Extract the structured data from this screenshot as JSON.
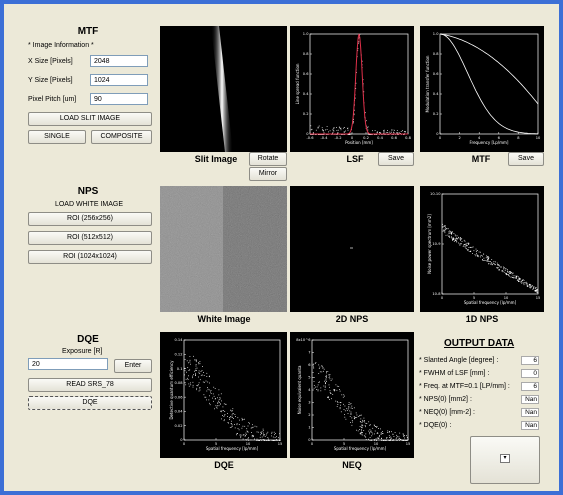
{
  "mtf": {
    "title": "MTF",
    "image_info": "* Image Information *",
    "x_size_label": "X Size [Pixels]",
    "x_size_value": "2048",
    "y_size_label": "Y Size [Pixels]",
    "y_size_value": "1024",
    "pixel_pitch_label": "Pixel Pitch [um]",
    "pixel_pitch_value": "90",
    "load_slit_image": "LOAD SLIT IMAGE",
    "single": "SINGLE",
    "composite": "COMPOSITE"
  },
  "nps": {
    "title": "NPS",
    "load_white_image": "LOAD WHITE IMAGE",
    "roi_256": "ROI (256x256)",
    "roi_512": "ROI (512x512)",
    "roi_1024": "ROI (1024x1024)"
  },
  "dqe": {
    "title": "DQE",
    "exposure_label": "Exposure [R]",
    "exposure_value": "20",
    "enter": "Enter",
    "read_srs": "READ SRS_78",
    "dqe_button": "DQE"
  },
  "panels": {
    "slit_image": "Slit Image",
    "rotate": "Rotate",
    "mirror": "Mirror",
    "lsf": "LSF",
    "lsf_save": "Save",
    "mtf": "MTF",
    "mtf_save": "Save",
    "white_image": "White Image",
    "nps_2d": "2D NPS",
    "nps_1d": "1D NPS",
    "dqe": "DQE",
    "neq": "NEQ"
  },
  "plots": {
    "lsf": {
      "ylabel": "Line spread function",
      "xlabel": "Position [mm]",
      "xticks": [
        "-0.6",
        "-0.4",
        "-0.2",
        "0",
        "0.2",
        "0.4",
        "0.6",
        "0.8"
      ],
      "yticks": [
        "0",
        "0.2",
        "0.4",
        "0.6",
        "0.8",
        "1.0"
      ]
    },
    "mtf": {
      "ylabel": "Modulation transfer function",
      "xlabel": "Frequency [Lp/mm]",
      "xticks": [
        "0",
        "2",
        "4",
        "6",
        "8",
        "10"
      ],
      "yticks": [
        "0",
        "0.2",
        "0.4",
        "0.6",
        "0.8",
        "1.0"
      ]
    },
    "nps1d": {
      "ylabel": "Noise power spectrum [mm2]",
      "xlabel": "Spatial frequency [lp/mm]",
      "xticks": [
        "0",
        "5",
        "10",
        "15"
      ],
      "yticks": [
        "10-8",
        "10-9",
        "10-10"
      ]
    },
    "dqe": {
      "ylabel": "Detective quantum efficiency",
      "xlabel": "Spatial frequency [lp/mm]",
      "xticks": [
        "0",
        "5",
        "10",
        "15"
      ],
      "yticks": [
        "0",
        "0.02",
        "0.04",
        "0.06",
        "0.08",
        "0.1",
        "0.12",
        "0.14"
      ]
    },
    "neq": {
      "ylabel": "Noise equivalent quanta",
      "xlabel": "Spatial frequency [lp/mm]",
      "xticks": [
        "0",
        "5",
        "10",
        "15"
      ],
      "yticks": [
        "0",
        "1",
        "2",
        "3",
        "4",
        "5",
        "6",
        "7",
        "8x10^6"
      ]
    }
  },
  "output": {
    "title": "OUTPUT DATA",
    "rows": [
      {
        "label": "* Slanted Angle [degree] :",
        "value": "6"
      },
      {
        "label": "* FWHM of LSF [mm] :",
        "value": "0"
      },
      {
        "label": "* Freq. at MTF=0.1 [LP/mm] :",
        "value": "6"
      },
      {
        "label": "* NPS(0) [mm2] :",
        "value": "Nan"
      },
      {
        "label": "* NEQ(0) [mm-2] :",
        "value": "Nan"
      },
      {
        "label": "* DQE(0) :",
        "value": "Nan"
      }
    ]
  },
  "colors": {
    "frame": "#3c6fd6",
    "background": "#ece9d8",
    "panel": "#000000",
    "lsf_fit": "#e0304a"
  }
}
